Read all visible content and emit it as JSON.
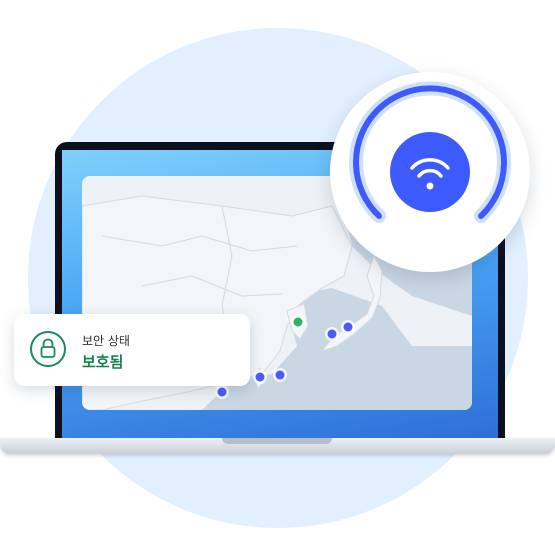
{
  "status_card": {
    "label": "보안 상태",
    "value": "보호됨",
    "icon": "lock-icon"
  },
  "connection": {
    "icon": "wifi-icon"
  },
  "map": {
    "markers": [
      {
        "status": "active",
        "color": "#2fb36b"
      },
      {
        "status": "server",
        "color": "#4a5cff"
      },
      {
        "status": "server",
        "color": "#4a5cff"
      },
      {
        "status": "server",
        "color": "#4a5cff"
      },
      {
        "status": "server",
        "color": "#4a5cff"
      },
      {
        "status": "server",
        "color": "#4a5cff"
      }
    ]
  },
  "colors": {
    "accent_blue": "#3d5afe",
    "secure_green": "#17824d",
    "background_circle": "#e2efff"
  }
}
